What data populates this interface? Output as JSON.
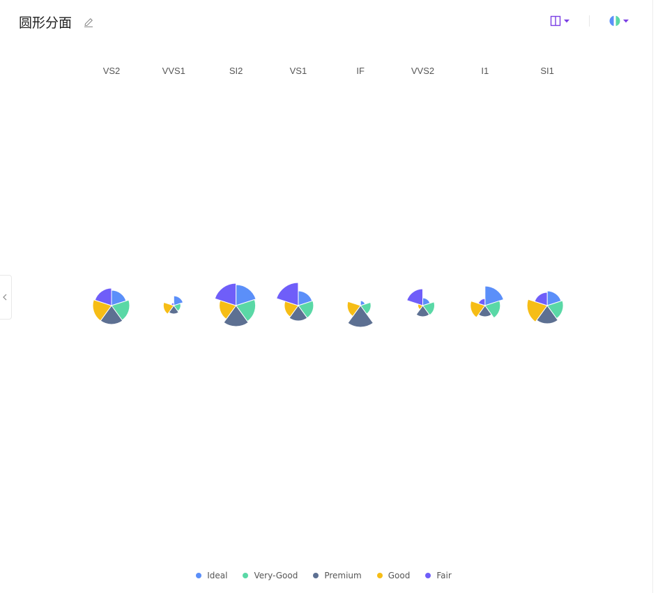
{
  "header": {
    "title": "圆形分面",
    "edit_icon": "pencil-icon",
    "layout_icon": "columns-icon",
    "theme_icon": "palette-icon",
    "accent_color": "#7b3fe4"
  },
  "colors": {
    "Ideal": "#5b8ff9",
    "Very-Good": "#5ad8a6",
    "Premium": "#5d7092",
    "Good": "#f6bd16",
    "Fair": "#6f5ef9"
  },
  "chart_data": {
    "type": "pie",
    "variant": "rose-facet",
    "facets": [
      "VS2",
      "VVS1",
      "SI2",
      "VS1",
      "IF",
      "VVS2",
      "I1",
      "SI1"
    ],
    "series": [
      "Ideal",
      "Very-Good",
      "Premium",
      "Good",
      "Fair"
    ],
    "values": [
      [
        22,
        26,
        27,
        27,
        25
      ],
      [
        14,
        10,
        12,
        15,
        4
      ],
      [
        30,
        28,
        30,
        24,
        32
      ],
      [
        21,
        22,
        22,
        20,
        33
      ],
      [
        7,
        15,
        31,
        19,
        0
      ],
      [
        11,
        17,
        16,
        7,
        24
      ],
      [
        28,
        22,
        16,
        21,
        10
      ],
      [
        21,
        23,
        26,
        29,
        19
      ]
    ],
    "legend": [
      "Ideal",
      "Very-Good",
      "Premium",
      "Good",
      "Fair"
    ],
    "legend_position": "bottom"
  }
}
